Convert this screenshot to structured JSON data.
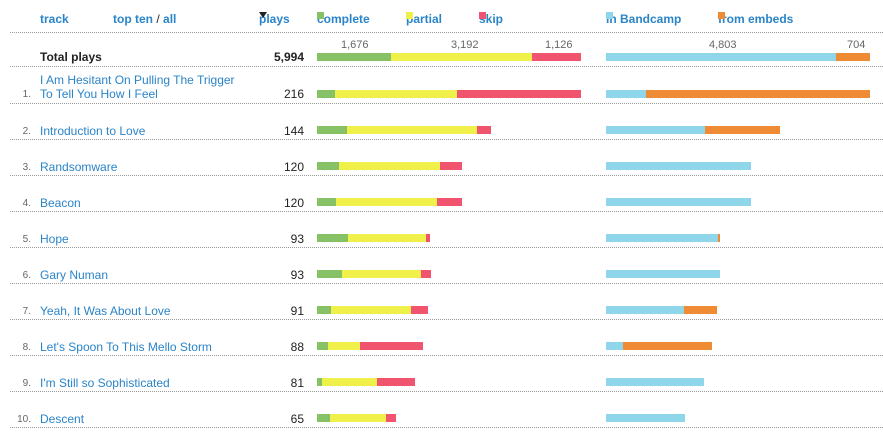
{
  "header": {
    "track": "track",
    "topten": "top ten",
    "slash": " / ",
    "all": "all",
    "plays": "plays",
    "legend": {
      "complete": "complete",
      "partial": "partial",
      "skip": "skip",
      "in_bandcamp": "in Bandcamp",
      "from_embeds": "from embeds"
    }
  },
  "colors": {
    "complete": "#86c166",
    "partial": "#f0f04a",
    "skip": "#f0546e",
    "bandcamp": "#8fd6ea",
    "embeds": "#ee8b34",
    "link": "#2a84c8"
  },
  "totals": {
    "label": "Total plays",
    "plays": "5,994",
    "complete": 1676,
    "partial": 3192,
    "skip": 1126,
    "complete_label": "1,676",
    "partial_label": "3,192",
    "skip_label": "1,126",
    "bandcamp": 4803,
    "embeds": 704,
    "bandcamp_label": "4,803",
    "embeds_label": "704"
  },
  "tracks": [
    {
      "rank": "1.",
      "title": "I Am Hesitant On Pulling The Trigger To Tell You How I Feel",
      "plays": 216,
      "complete": 18,
      "partial": 122,
      "skip": 124,
      "bandcamp": 40,
      "embeds": 224
    },
    {
      "rank": "2.",
      "title": "Introduction to Love",
      "plays": 144,
      "complete": 30,
      "partial": 130,
      "skip": 14,
      "bandcamp": 99,
      "embeds": 75
    },
    {
      "rank": "3.",
      "title": "Randsomware",
      "plays": 120,
      "complete": 22,
      "partial": 101,
      "skip": 22,
      "bandcamp": 145,
      "embeds": 0
    },
    {
      "rank": "4.",
      "title": "Beacon",
      "plays": 120,
      "complete": 19,
      "partial": 101,
      "skip": 25,
      "bandcamp": 145,
      "embeds": 0
    },
    {
      "rank": "5.",
      "title": "Hope",
      "plays": 93,
      "complete": 31,
      "partial": 78,
      "skip": 4,
      "bandcamp": 112,
      "embeds": 2
    },
    {
      "rank": "6.",
      "title": "Gary Numan",
      "plays": 93,
      "complete": 25,
      "partial": 79,
      "skip": 10,
      "bandcamp": 114,
      "embeds": 0
    },
    {
      "rank": "7.",
      "title": "Yeah, It Was About Love",
      "plays": 91,
      "complete": 14,
      "partial": 80,
      "skip": 17,
      "bandcamp": 78,
      "embeds": 33
    },
    {
      "rank": "8.",
      "title": "Let's Spoon To This Mello Storm",
      "plays": 88,
      "complete": 11,
      "partial": 32,
      "skip": 63,
      "bandcamp": 17,
      "embeds": 89
    },
    {
      "rank": "9.",
      "title": "I'm Still so Sophisticated",
      "plays": 81,
      "complete": 5,
      "partial": 55,
      "skip": 38,
      "bandcamp": 98,
      "embeds": 0
    },
    {
      "rank": "10.",
      "title": "Descent",
      "plays": 65,
      "complete": 13,
      "partial": 56,
      "skip": 10,
      "bandcamp": 79,
      "embeds": 0
    }
  ]
}
